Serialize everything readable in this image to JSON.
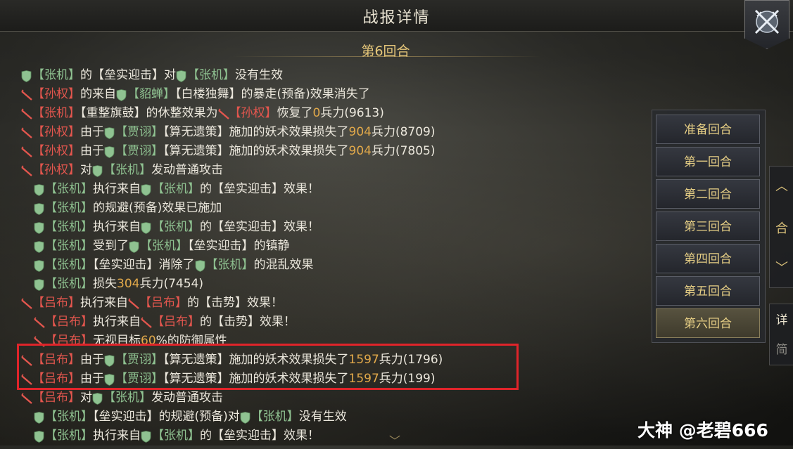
{
  "window": {
    "title": "战报详情"
  },
  "round_title": "第6回合",
  "rounds": [
    "准备回合",
    "第一回合",
    "第二回合",
    "第三回合",
    "第四回合",
    "第五回合",
    "第六回合"
  ],
  "active_round_index": 6,
  "side_controls": {
    "up": "︿",
    "merge": "合",
    "down": "﹀"
  },
  "view_tabs": {
    "detail": "详",
    "simple": "简"
  },
  "watermark": "大神 @老碧666",
  "colors": {
    "ally": "#8fc291",
    "enemy": "#e3564e",
    "number": "#e2a94a",
    "highlight": "#e0242a"
  },
  "lines": [
    {
      "indent": 0,
      "segs": [
        [
          "shield",
          ""
        ],
        [
          "g",
          "【张机】"
        ],
        [
          "w",
          "的【垒实迎击】对"
        ],
        [
          "shield",
          ""
        ],
        [
          "g",
          "【张机】"
        ],
        [
          "w",
          "没有生效"
        ]
      ]
    },
    {
      "indent": 0,
      "segs": [
        [
          "sword",
          ""
        ],
        [
          "r",
          "【孙权】"
        ],
        [
          "w",
          "的来自"
        ],
        [
          "shield",
          ""
        ],
        [
          "g",
          "【貂蝉】"
        ],
        [
          "w",
          "【白楼独舞】的暴走(预备)效果消失了"
        ]
      ]
    },
    {
      "indent": 0,
      "segs": [
        [
          "sword",
          ""
        ],
        [
          "r",
          "【张机】"
        ],
        [
          "w",
          "【重整旗鼓】的休整效果为"
        ],
        [
          "sword",
          ""
        ],
        [
          "r",
          "【孙权】"
        ],
        [
          "w",
          "恢复了"
        ],
        [
          "o",
          "0"
        ],
        [
          "w",
          "兵力(9613)"
        ]
      ]
    },
    {
      "indent": 0,
      "segs": [
        [
          "sword",
          ""
        ],
        [
          "r",
          "【孙权】"
        ],
        [
          "w",
          "由于"
        ],
        [
          "shield",
          ""
        ],
        [
          "g",
          "【贾诩】"
        ],
        [
          "w",
          "【算无遗策】施加的妖术效果损失了"
        ],
        [
          "o",
          "904"
        ],
        [
          "w",
          "兵力(8709)"
        ]
      ]
    },
    {
      "indent": 0,
      "segs": [
        [
          "sword",
          ""
        ],
        [
          "r",
          "【孙权】"
        ],
        [
          "w",
          "由于"
        ],
        [
          "shield",
          ""
        ],
        [
          "g",
          "【贾诩】"
        ],
        [
          "w",
          "【算无遗策】施加的妖术效果损失了"
        ],
        [
          "o",
          "904"
        ],
        [
          "w",
          "兵力(7805)"
        ]
      ]
    },
    {
      "indent": 0,
      "segs": [
        [
          "sword",
          ""
        ],
        [
          "r",
          "【孙权】"
        ],
        [
          "w",
          "对"
        ],
        [
          "shield",
          ""
        ],
        [
          "g",
          "【张机】"
        ],
        [
          "w",
          "发动普通攻击"
        ]
      ]
    },
    {
      "indent": 1,
      "segs": [
        [
          "shield",
          ""
        ],
        [
          "g",
          "【张机】"
        ],
        [
          "w",
          "执行来自"
        ],
        [
          "shield",
          ""
        ],
        [
          "g",
          "【张机】"
        ],
        [
          "w",
          "的【垒实迎击】效果！"
        ]
      ]
    },
    {
      "indent": 1,
      "segs": [
        [
          "shield",
          ""
        ],
        [
          "g",
          "【张机】"
        ],
        [
          "w",
          "的规避(预备)效果已施加"
        ]
      ]
    },
    {
      "indent": 1,
      "segs": [
        [
          "shield",
          ""
        ],
        [
          "g",
          "【张机】"
        ],
        [
          "w",
          "执行来自"
        ],
        [
          "shield",
          ""
        ],
        [
          "g",
          "【张机】"
        ],
        [
          "w",
          "的【垒实迎击】效果！"
        ]
      ]
    },
    {
      "indent": 1,
      "segs": [
        [
          "shield",
          ""
        ],
        [
          "g",
          "【张机】"
        ],
        [
          "w",
          "受到了"
        ],
        [
          "shield",
          ""
        ],
        [
          "g",
          "【张机】"
        ],
        [
          "w",
          "【垒实迎击】的镇静"
        ]
      ]
    },
    {
      "indent": 1,
      "segs": [
        [
          "shield",
          ""
        ],
        [
          "g",
          "【张机】"
        ],
        [
          "w",
          "【垒实迎击】消除了"
        ],
        [
          "shield",
          ""
        ],
        [
          "g",
          "【张机】"
        ],
        [
          "w",
          "的混乱效果"
        ]
      ]
    },
    {
      "indent": 1,
      "segs": [
        [
          "shield",
          ""
        ],
        [
          "g",
          "【张机】"
        ],
        [
          "w",
          "损失"
        ],
        [
          "o",
          "304"
        ],
        [
          "w",
          "兵力(7454)"
        ]
      ]
    },
    {
      "indent": 0,
      "segs": [
        [
          "sword",
          ""
        ],
        [
          "r",
          "【吕布】"
        ],
        [
          "w",
          "执行来自"
        ],
        [
          "sword",
          ""
        ],
        [
          "r",
          "【吕布】"
        ],
        [
          "w",
          "的【击势】效果！"
        ]
      ]
    },
    {
      "indent": 1,
      "segs": [
        [
          "sword",
          ""
        ],
        [
          "r",
          "【吕布】"
        ],
        [
          "w",
          "执行来自"
        ],
        [
          "sword",
          ""
        ],
        [
          "r",
          "【吕布】"
        ],
        [
          "w",
          "的【击势】效果！"
        ]
      ]
    },
    {
      "indent": 1,
      "segs": [
        [
          "sword",
          ""
        ],
        [
          "r",
          "【吕布】"
        ],
        [
          "w",
          "无视目标"
        ],
        [
          "o",
          "60"
        ],
        [
          "w",
          "%的防御属性"
        ]
      ]
    },
    {
      "indent": 0,
      "segs": [
        [
          "sword",
          ""
        ],
        [
          "r",
          "【吕布】"
        ],
        [
          "w",
          "由于"
        ],
        [
          "shield",
          ""
        ],
        [
          "g",
          "【贾诩】"
        ],
        [
          "w",
          "【算无遗策】施加的妖术效果损失了"
        ],
        [
          "o",
          "1597"
        ],
        [
          "w",
          "兵力(1796)"
        ]
      ]
    },
    {
      "indent": 0,
      "segs": [
        [
          "sword",
          ""
        ],
        [
          "r",
          "【吕布】"
        ],
        [
          "w",
          "由于"
        ],
        [
          "shield",
          ""
        ],
        [
          "g",
          "【贾诩】"
        ],
        [
          "w",
          "【算无遗策】施加的妖术效果损失了"
        ],
        [
          "o",
          "1597"
        ],
        [
          "w",
          "兵力(199)"
        ]
      ]
    },
    {
      "indent": 0,
      "segs": [
        [
          "sword",
          ""
        ],
        [
          "r",
          "【吕布】"
        ],
        [
          "w",
          "对"
        ],
        [
          "shield",
          ""
        ],
        [
          "g",
          "【张机】"
        ],
        [
          "w",
          "发动普通攻击"
        ]
      ]
    },
    {
      "indent": 1,
      "segs": [
        [
          "shield",
          ""
        ],
        [
          "g",
          "【张机】"
        ],
        [
          "w",
          "【垒实迎击】的规避(预备)对"
        ],
        [
          "shield",
          ""
        ],
        [
          "g",
          "【张机】"
        ],
        [
          "w",
          "没有生效"
        ]
      ]
    },
    {
      "indent": 1,
      "segs": [
        [
          "shield",
          ""
        ],
        [
          "g",
          "【张机】"
        ],
        [
          "w",
          "执行来自"
        ],
        [
          "shield",
          ""
        ],
        [
          "g",
          "【张机】"
        ],
        [
          "w",
          "的【垒实迎击】效果！"
        ]
      ]
    }
  ]
}
